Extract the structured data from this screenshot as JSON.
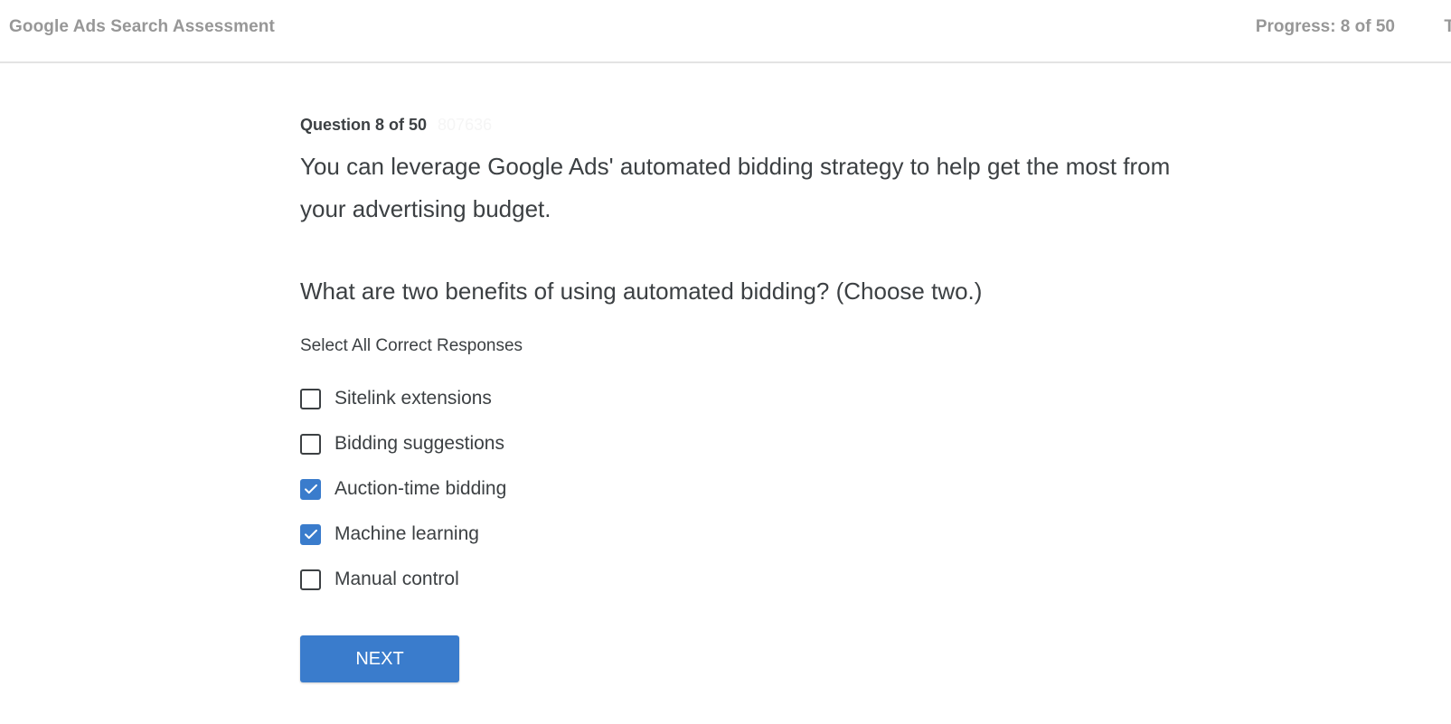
{
  "header": {
    "title": "Google Ads Search Assessment",
    "progress": "Progress: 8 of 50",
    "edge_glyph": "T"
  },
  "question": {
    "label": "Question 8 of 50",
    "id": "807636",
    "text": "You can leverage Google Ads' automated bidding strategy to help get the most from your advertising budget.",
    "prompt": "What are two benefits of using automated bidding? (Choose two.)",
    "hint": "Select All Correct Responses",
    "options": [
      {
        "label": "Sitelink extensions",
        "checked": false
      },
      {
        "label": "Bidding suggestions",
        "checked": false
      },
      {
        "label": "Auction-time bidding",
        "checked": true
      },
      {
        "label": "Machine learning",
        "checked": true
      },
      {
        "label": "Manual control",
        "checked": false
      }
    ]
  },
  "actions": {
    "next_label": "NEXT"
  },
  "colors": {
    "accent": "#3a7ccc",
    "text": "#3c4043",
    "muted": "#979797"
  }
}
